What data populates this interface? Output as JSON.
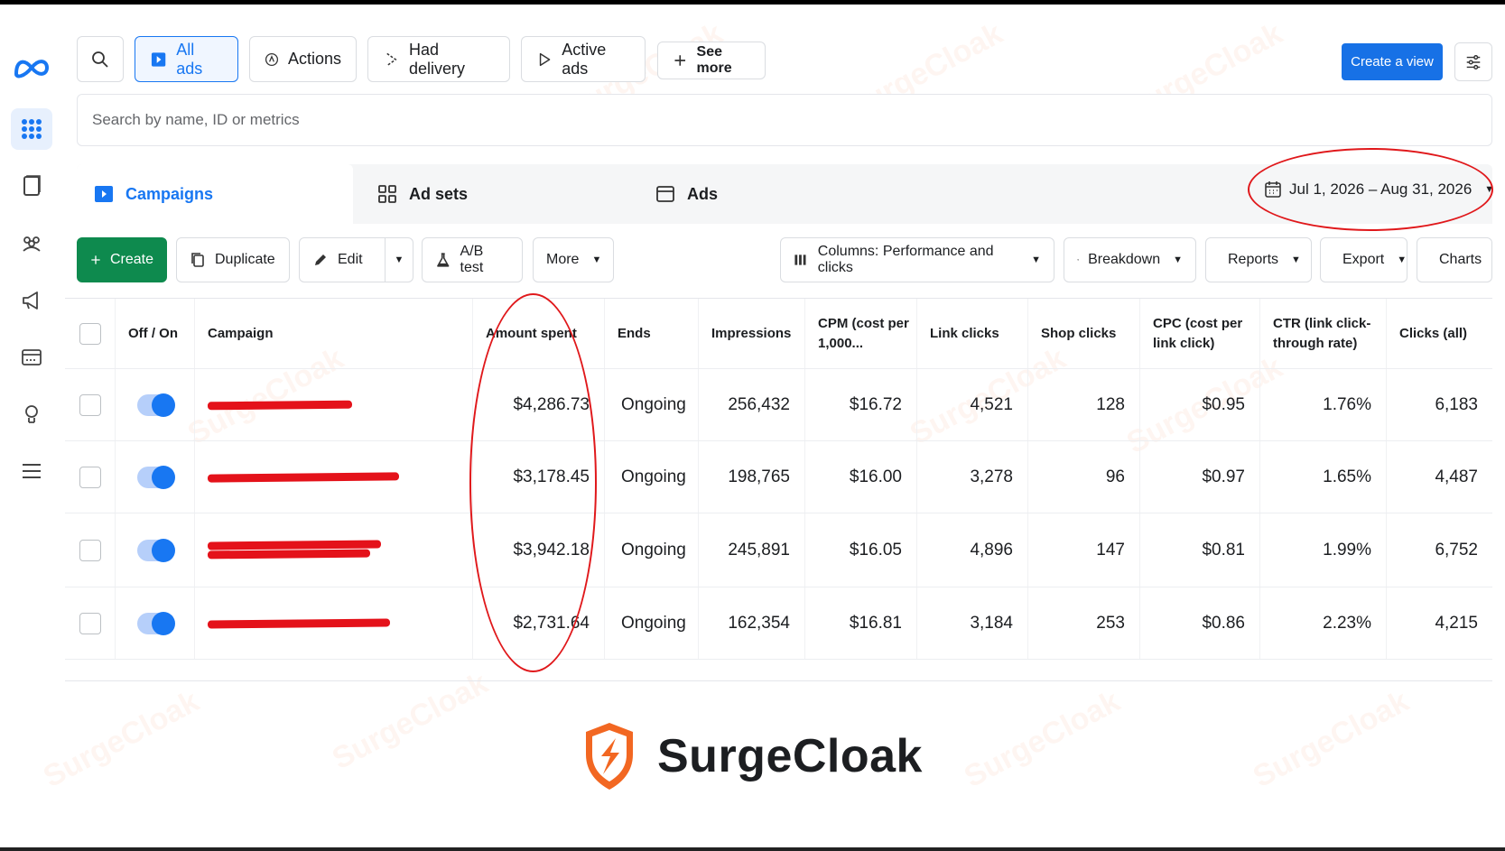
{
  "filters": {
    "all_ads": "All ads",
    "actions": "Actions",
    "had_delivery": "Had delivery",
    "active_ads": "Active ads",
    "see_more": "See more",
    "create_view": "Create a view"
  },
  "search": {
    "placeholder": "Search by name, ID or metrics"
  },
  "tabs": {
    "campaigns": "Campaigns",
    "ad_sets": "Ad sets",
    "ads": "Ads"
  },
  "date_range": "Jul 1, 2026 – Aug 31, 2026",
  "toolbar": {
    "create": "Create",
    "duplicate": "Duplicate",
    "edit": "Edit",
    "ab_test": "A/B test",
    "more": "More",
    "columns": "Columns: Performance and clicks",
    "breakdown": "Breakdown",
    "reports": "Reports",
    "export": "Export",
    "charts": "Charts"
  },
  "table": {
    "headers": {
      "off_on": "Off / On",
      "campaign": "Campaign",
      "amount_spent": "Amount spent",
      "ends": "Ends",
      "impressions": "Impressions",
      "cpm": "CPM (cost per 1,000...",
      "link_clicks": "Link clicks",
      "shop_clicks": "Shop clicks",
      "cpc": "CPC (cost per link click)",
      "ctr": "CTR (link click-through rate)",
      "clicks_all": "Clicks (all)"
    },
    "rows": [
      {
        "amount": "$4,286.73",
        "ends": "Ongoing",
        "impressions": "256,432",
        "cpm": "$16.72",
        "link_clicks": "4,521",
        "shop_clicks": "128",
        "cpc": "$0.95",
        "ctr": "1.76%",
        "clicks_all": "6,183"
      },
      {
        "amount": "$3,178.45",
        "ends": "Ongoing",
        "impressions": "198,765",
        "cpm": "$16.00",
        "link_clicks": "3,278",
        "shop_clicks": "96",
        "cpc": "$0.97",
        "ctr": "1.65%",
        "clicks_all": "4,487"
      },
      {
        "amount": "$3,942.18",
        "ends": "Ongoing",
        "impressions": "245,891",
        "cpm": "$16.05",
        "link_clicks": "4,896",
        "shop_clicks": "147",
        "cpc": "$0.81",
        "ctr": "1.99%",
        "clicks_all": "6,752"
      },
      {
        "amount": "$2,731.64",
        "ends": "Ongoing",
        "impressions": "162,354",
        "cpm": "$16.81",
        "link_clicks": "3,184",
        "shop_clicks": "253",
        "cpc": "$0.86",
        "ctr": "2.23%",
        "clicks_all": "4,215"
      }
    ]
  },
  "brand": {
    "name": "SurgeCloak",
    "watermark": "SurgeCloak"
  },
  "colors": {
    "accent": "#1877f2",
    "create_green": "#0e8a4e",
    "annotation_red": "#e0181b",
    "brand_orange": "#f26722"
  }
}
